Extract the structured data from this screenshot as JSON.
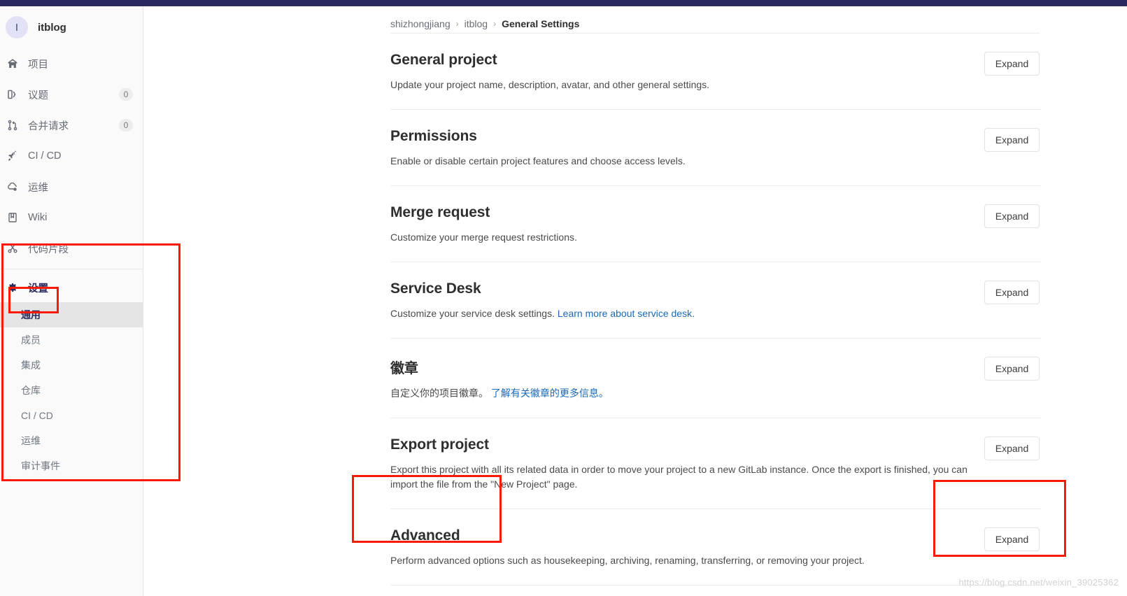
{
  "window": {
    "topbar_color": "#292961",
    "accent_color": "#2b2b5e",
    "link_color": "#1b69b6",
    "annotation_color": "#fb1b05"
  },
  "sidebar": {
    "project": {
      "avatar_initial": "I",
      "name": "itblog"
    },
    "nav": [
      {
        "icon": "home-icon",
        "label": "项目",
        "badge": ""
      },
      {
        "icon": "issues-icon",
        "label": "议题",
        "badge": "0"
      },
      {
        "icon": "merge-request-icon",
        "label": "合并请求",
        "badge": "0"
      },
      {
        "icon": "rocket-icon",
        "label": "CI / CD",
        "badge": ""
      },
      {
        "icon": "operations-icon",
        "label": "运维",
        "badge": ""
      },
      {
        "icon": "wiki-icon",
        "label": "Wiki",
        "badge": ""
      },
      {
        "icon": "snippets-icon",
        "label": "代码片段",
        "badge": ""
      }
    ],
    "settings": {
      "icon": "gear-icon",
      "label": "设置",
      "items": [
        {
          "label": "通用",
          "active": true
        },
        {
          "label": "成员",
          "active": false
        },
        {
          "label": "集成",
          "active": false
        },
        {
          "label": "仓库",
          "active": false
        },
        {
          "label": "CI / CD",
          "active": false
        },
        {
          "label": "运维",
          "active": false
        },
        {
          "label": "审计事件",
          "active": false
        }
      ]
    }
  },
  "breadcrumb": {
    "separator": "›",
    "items": [
      "shizhongjiang",
      "itblog",
      "General Settings"
    ]
  },
  "main": {
    "expand_label": "Expand",
    "sections": [
      {
        "title": "General project",
        "description": "Update your project name, description, avatar, and other general settings.",
        "link_text": "",
        "expand_label": "Expand"
      },
      {
        "title": "Permissions",
        "description": "Enable or disable certain project features and choose access levels.",
        "link_text": "",
        "expand_label": "Expand"
      },
      {
        "title": "Merge request",
        "description": "Customize your merge request restrictions.",
        "link_text": "",
        "expand_label": "Expand"
      },
      {
        "title": "Service Desk",
        "description": "Customize your service desk settings.",
        "link_text": "Learn more about service desk.",
        "expand_label": "Expand"
      },
      {
        "title": "徽章",
        "description": "自定义你的项目徽章。",
        "link_text": "了解有关徽章的更多信息。",
        "expand_label": "Expand"
      },
      {
        "title": "Export project",
        "description": "Export this project with all its related data in order to move your project to a new GitLab instance. Once the export is finished, you can import the file from the \"New Project\" page.",
        "link_text": "",
        "expand_label": "Expand"
      },
      {
        "title": "Advanced",
        "description": "Perform advanced options such as housekeeping, archiving, renaming, transferring, or removing your project.",
        "link_text": "",
        "expand_label": "Expand"
      }
    ]
  },
  "watermark": {
    "text": "https://blog.csdn.net/weixin_39025362"
  }
}
